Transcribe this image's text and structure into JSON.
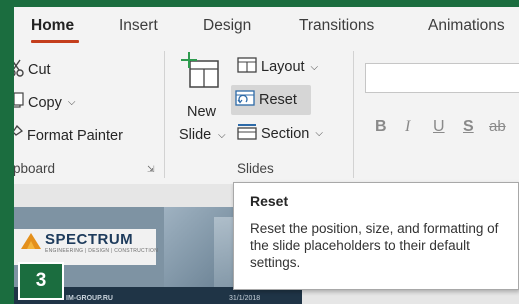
{
  "tabs": [
    {
      "label": "Home",
      "active": true
    },
    {
      "label": "Insert"
    },
    {
      "label": "Design"
    },
    {
      "label": "Transitions"
    },
    {
      "label": "Animations"
    }
  ],
  "clipboard": {
    "cut": "Cut",
    "copy": "Copy",
    "format_painter": "Format Painter",
    "group_label": "pboard"
  },
  "slides": {
    "new_slide_line1": "New",
    "new_slide_line2": "Slide",
    "layout": "Layout",
    "reset": "Reset",
    "section": "Section",
    "group_label": "Slides"
  },
  "font_group": {
    "bold": "B",
    "italic": "I",
    "underline": "U",
    "shadow": "S",
    "strikethrough": "ab"
  },
  "tooltip": {
    "title": "Reset",
    "body": "Reset the position, size, and formatting of the slide placeholders to their default settings."
  },
  "slide_preview": {
    "logo": "SPECTRUM",
    "logo_sub": "ENGINEERING | DESIGN | CONSTRUCTION",
    "footer_left": "IM-GROUP.RU",
    "footer_right": "31/1/2018"
  },
  "step_badge": "3",
  "colors": {
    "accent_green": "#1b6d3f",
    "tab_underline": "#c43e1c",
    "ribbon_bg": "#f3f3f3"
  }
}
